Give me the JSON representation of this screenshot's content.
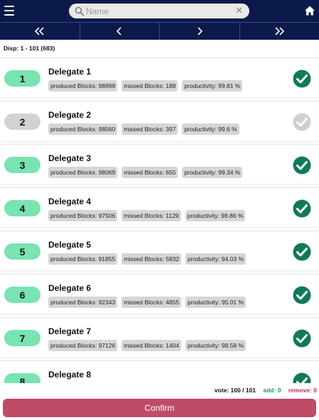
{
  "header": {
    "search": {
      "placeholder": "Name",
      "value": ""
    },
    "icons": {
      "menu": "hamburger-menu-icon",
      "search": "search-icon",
      "clear": "clear-icon",
      "home": "home-icon"
    }
  },
  "pager": {
    "buttons": [
      {
        "name": "first-page-button",
        "icon": "double-chevron-left-icon"
      },
      {
        "name": "prev-page-button",
        "icon": "chevron-left-icon"
      },
      {
        "name": "next-page-button",
        "icon": "chevron-right-icon"
      },
      {
        "name": "last-page-button",
        "icon": "double-chevron-right-icon"
      }
    ]
  },
  "display_range": "Disp: 1 - 101 (683)",
  "delegates": [
    {
      "rank": "1",
      "name": "Delegate 1",
      "produced": "produced Blocks: 98898",
      "missed": "missed Blocks: 188",
      "productivity": "productivity: 99.81 %",
      "voted": true
    },
    {
      "rank": "2",
      "name": "Delegate 2",
      "produced": "produced Blocks: 98560",
      "missed": "missed Blocks: 397",
      "productivity": "productivity: 99.6 %",
      "voted": false
    },
    {
      "rank": "3",
      "name": "Delegate 3",
      "produced": "produced Blocks: 98069",
      "missed": "missed Blocks: 655",
      "productivity": "productivity: 99.34 %",
      "voted": true
    },
    {
      "rank": "4",
      "name": "Delegate 4",
      "produced": "produced Blocks: 97506",
      "missed": "missed Blocks: 1129",
      "productivity": "productivity: 98.86 %",
      "voted": true
    },
    {
      "rank": "5",
      "name": "Delegate 5",
      "produced": "produced Blocks: 91855",
      "missed": "missed Blocks: 5832",
      "productivity": "productivity: 94.03 %",
      "voted": true
    },
    {
      "rank": "6",
      "name": "Delegate 6",
      "produced": "produced Blocks: 92343",
      "missed": "missed Blocks: 4855",
      "productivity": "productivity: 95.01 %",
      "voted": true
    },
    {
      "rank": "7",
      "name": "Delegate 7",
      "produced": "produced Blocks: 97126",
      "missed": "missed Blocks: 1404",
      "productivity": "productivity: 98.58 %",
      "voted": true
    },
    {
      "rank": "8",
      "name": "Delegate 8",
      "produced": "",
      "missed": "",
      "productivity": "",
      "voted": true
    }
  ],
  "footer": {
    "vote_label": "vote:",
    "vote_count": "100",
    "vote_sep": "/",
    "vote_total": "101",
    "add_label": "add:",
    "add_count": "0",
    "remove_label": "remove:",
    "remove_count": "0",
    "confirm_label": "Confirm"
  },
  "colors": {
    "header_bg": "#0b1a4a",
    "rank_on": "#79e3b2",
    "rank_off": "#d2d2d2",
    "check_on": "#0f7a5a",
    "check_off": "#cfcfcf",
    "confirm_bg": "#be4c68"
  }
}
